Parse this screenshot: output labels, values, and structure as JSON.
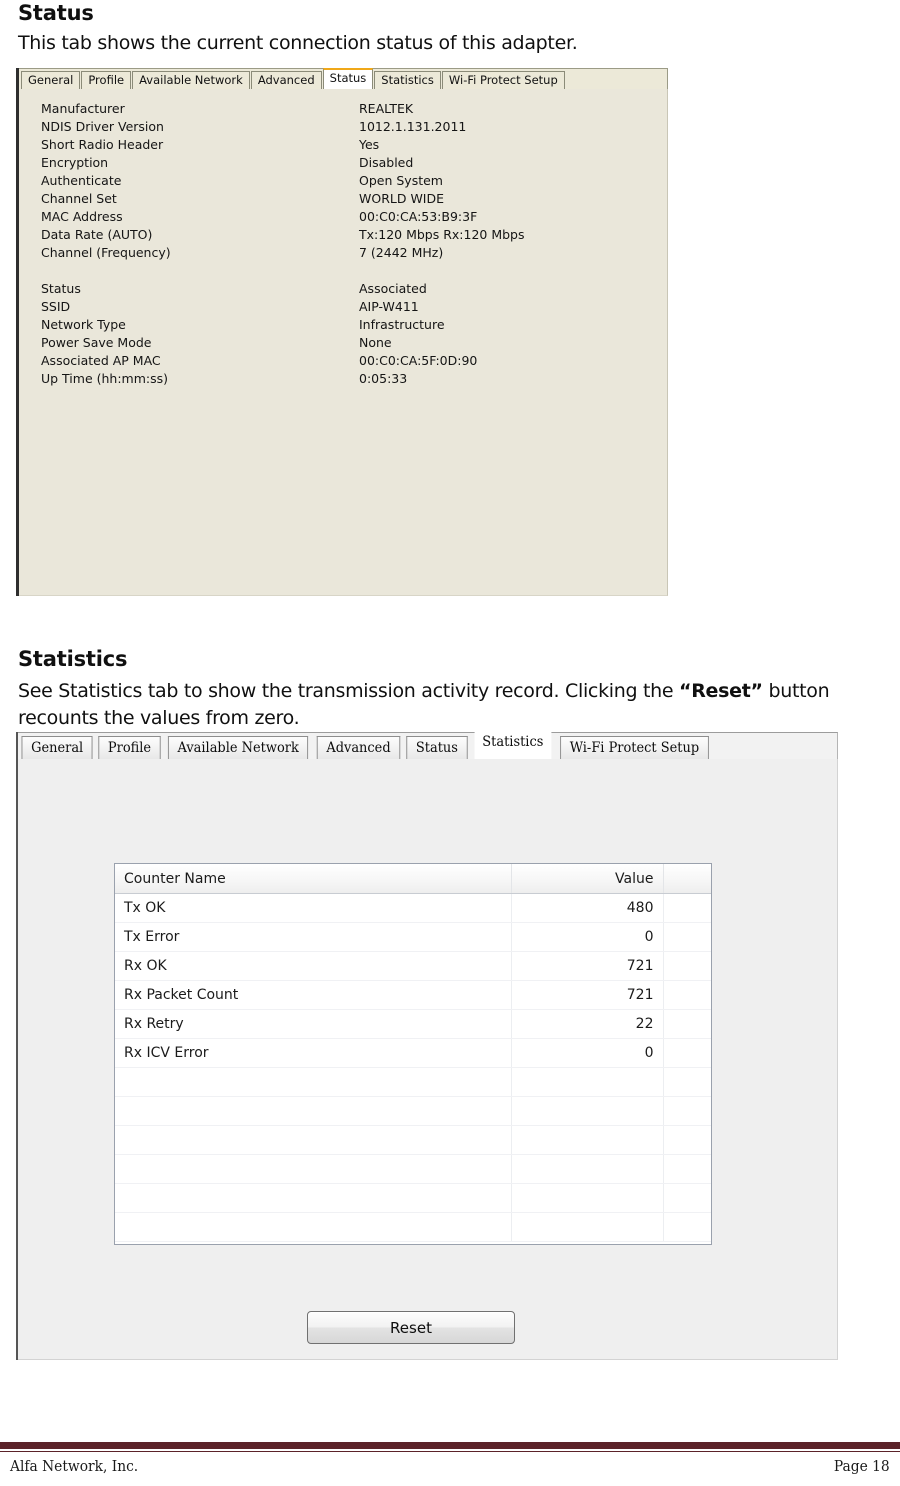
{
  "page": {
    "status_section": {
      "heading": "Status",
      "body": "This tab shows the current connection status of this adapter."
    },
    "statistics_section": {
      "heading": "Statistics",
      "body_before": "See Statistics tab to show the transmission activity record. Clicking the ",
      "body_emphasis": "“Reset”",
      "body_after": " button recounts the values from zero."
    }
  },
  "status_window": {
    "tabs": [
      {
        "label": "General",
        "active": false
      },
      {
        "label": "Profile",
        "active": false
      },
      {
        "label": "Available Network",
        "active": false
      },
      {
        "label": "Advanced",
        "active": false
      },
      {
        "label": "Status",
        "active": true
      },
      {
        "label": "Statistics",
        "active": false
      },
      {
        "label": "Wi-Fi Protect Setup",
        "active": false
      }
    ],
    "active_tab": "Status",
    "accent_color": "#f0a819",
    "panel_color": "#eae7da",
    "group_one": [
      {
        "key": "Manufacturer",
        "value": "REALTEK"
      },
      {
        "key": "NDIS Driver Version",
        "value": "1012.1.131.2011"
      },
      {
        "key": "Short Radio Header",
        "value": "Yes"
      },
      {
        "key": "Encryption",
        "value": "Disabled"
      },
      {
        "key": "Authenticate",
        "value": "Open System"
      },
      {
        "key": "Channel Set",
        "value": "WORLD WIDE"
      },
      {
        "key": "MAC Address",
        "value": "00:C0:CA:53:B9:3F"
      },
      {
        "key": "Data Rate (AUTO)",
        "value": "Tx:120 Mbps Rx:120 Mbps"
      },
      {
        "key": "Channel (Frequency)",
        "value": "7 (2442 MHz)"
      }
    ],
    "group_two": [
      {
        "key": "Status",
        "value": "Associated"
      },
      {
        "key": "SSID",
        "value": "AIP-W411"
      },
      {
        "key": "Network Type",
        "value": "Infrastructure"
      },
      {
        "key": "Power Save Mode",
        "value": "None"
      },
      {
        "key": "Associated AP MAC",
        "value": "00:C0:CA:5F:0D:90"
      },
      {
        "key": "Up Time (hh:mm:ss)",
        "value": "0:05:33"
      }
    ]
  },
  "statistics_window": {
    "tabs": [
      {
        "label": "General",
        "active": false
      },
      {
        "label": "Profile",
        "active": false
      },
      {
        "label": "Available Network",
        "active": false
      },
      {
        "label": "Advanced",
        "active": false
      },
      {
        "label": "Status",
        "active": false
      },
      {
        "label": "Statistics",
        "active": true
      },
      {
        "label": "Wi-Fi Protect Setup",
        "active": false
      }
    ],
    "active_tab": "Statistics",
    "panel_color": "#efefef",
    "table": {
      "columns": [
        "Counter Name",
        "Value",
        ""
      ],
      "rows": [
        {
          "name": "Tx OK",
          "value": "480"
        },
        {
          "name": "Tx Error",
          "value": "0"
        },
        {
          "name": "Rx OK",
          "value": "721"
        },
        {
          "name": "Rx Packet Count",
          "value": "721"
        },
        {
          "name": "Rx Retry",
          "value": "22"
        },
        {
          "name": "Rx ICV Error",
          "value": "0"
        },
        {
          "name": "",
          "value": ""
        },
        {
          "name": "",
          "value": ""
        },
        {
          "name": "",
          "value": ""
        },
        {
          "name": "",
          "value": ""
        },
        {
          "name": "",
          "value": ""
        },
        {
          "name": "",
          "value": ""
        }
      ]
    },
    "reset_button": "Reset"
  },
  "footer": {
    "company": "Alfa Network, Inc.",
    "page": "Page 18",
    "rule_color": "#5b2229"
  }
}
